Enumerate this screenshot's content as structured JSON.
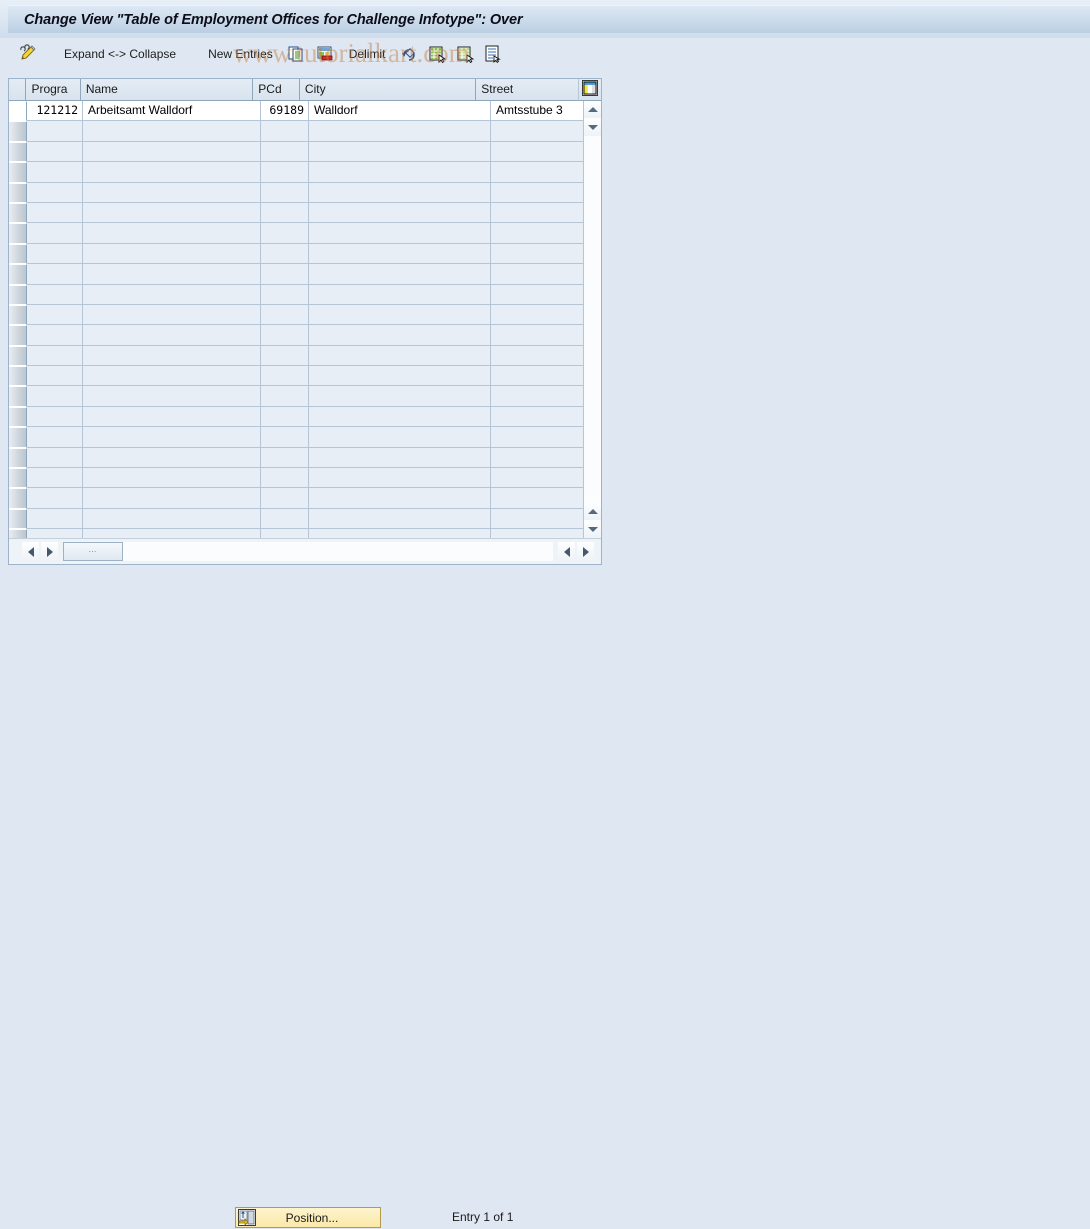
{
  "window": {
    "title": "Change View \"Table of Employment Offices for Challenge Infotype\": Over"
  },
  "watermark": {
    "text": "www.tutorialkart.com"
  },
  "toolbar": {
    "pencil_icon": "pencil-icon",
    "expand_collapse_label": "Expand <-> Collapse",
    "new_entries_label": "New Entries",
    "copy_icon": "copy-icon",
    "delete_icon": "delete-row-icon",
    "delimit_label": "Delimit",
    "undo_icon": "undo-icon",
    "select_all_icon": "select-all-icon",
    "deselect_all_icon": "deselect-all-icon",
    "variant_icon": "variant-icon"
  },
  "grid": {
    "config_icon": "table-settings-icon",
    "columns": [
      {
        "key": "progra",
        "label": "Progra"
      },
      {
        "key": "name",
        "label": "Name"
      },
      {
        "key": "pcd",
        "label": "PCd"
      },
      {
        "key": "city",
        "label": "City"
      },
      {
        "key": "street",
        "label": "Street"
      }
    ],
    "rows": [
      {
        "progra": "121212",
        "name": "Arbeitsamt Walldorf",
        "pcd": "69189",
        "city": "Walldorf",
        "street": "Amtsstube 3"
      }
    ],
    "empty_row_count": 21,
    "scroll": {
      "up_icon": "scroll-up-icon",
      "down_icon": "scroll-down-icon",
      "left_icon": "scroll-left-icon",
      "right_icon": "scroll-right-icon",
      "thumb_grip": "⋯"
    }
  },
  "footer": {
    "position_label": "Position...",
    "position_icon": "position-icon",
    "entry_status": "Entry 1 of 1"
  },
  "colors": {
    "window_bg": "#dfe8f2",
    "title_bar": "#cddcec",
    "grid_header": "#dde6ef",
    "row_alt": "#e8eef6",
    "selection": "#b9cade",
    "button_yellow": "#fbe9a8",
    "watermark": "#c47a3c"
  }
}
